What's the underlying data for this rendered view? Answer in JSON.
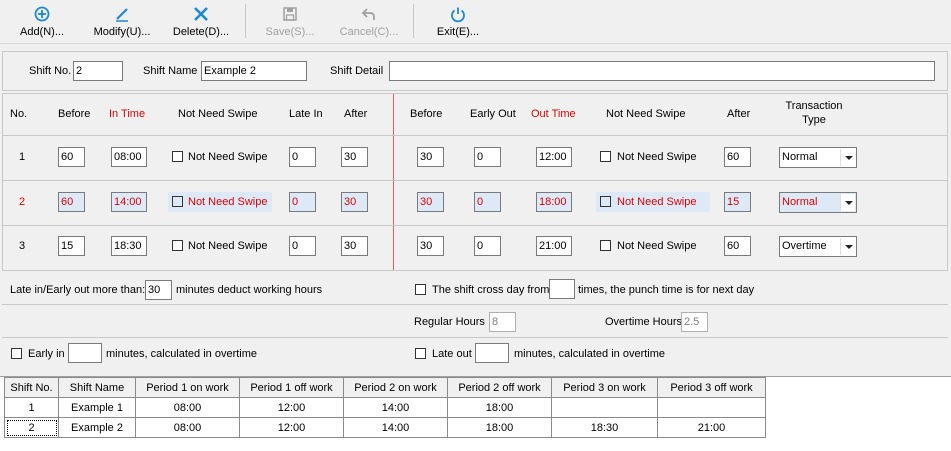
{
  "toolbar": {
    "add": "Add(N)...",
    "modify": "Modify(U)...",
    "delete": "Delete(D)...",
    "save": "Save(S)...",
    "cancel": "Cancel(C)...",
    "exit": "Exit(E)..."
  },
  "shift": {
    "no_label": "Shift No.",
    "no_value": "2",
    "name_label": "Shift Name",
    "name_value": "Example 2",
    "detail_label": "Shift Detail",
    "detail_value": ""
  },
  "headers": {
    "no": "No.",
    "before": "Before",
    "in_time": "In Time",
    "not_need_swipe": "Not Need Swipe",
    "late_in": "Late In",
    "after": "After",
    "before2": "Before",
    "early_out": "Early Out",
    "out_time": "Out Time",
    "not_need_swipe2": "Not Need Swipe",
    "after2": "After",
    "transaction_type": "Transaction Type"
  },
  "periods": [
    {
      "no": "1",
      "before": "60",
      "in_time": "08:00",
      "nns_label": "Not Need Swipe",
      "late_in": "0",
      "after": "30",
      "before2": "30",
      "early_out": "0",
      "out_time": "12:00",
      "nns2_label": "Not Need Swipe",
      "after2": "60",
      "type": "Normal"
    },
    {
      "no": "2",
      "before": "60",
      "in_time": "14:00",
      "nns_label": "Not Need Swipe",
      "late_in": "0",
      "after": "30",
      "before2": "30",
      "early_out": "0",
      "out_time": "18:00",
      "nns2_label": "Not Need Swipe",
      "after2": "15",
      "type": "Normal"
    },
    {
      "no": "3",
      "before": "15",
      "in_time": "18:30",
      "nns_label": "Not Need Swipe",
      "late_in": "0",
      "after": "30",
      "before2": "30",
      "early_out": "0",
      "out_time": "21:00",
      "nns2_label": "Not Need Swipe",
      "after2": "60",
      "type": "Overtime"
    }
  ],
  "options": {
    "late_early_prefix": "Late in/Early out more than:",
    "late_early_value": "30",
    "late_early_suffix": "minutes deduct working hours",
    "cross_day_prefix": "The shift cross day from",
    "cross_day_value": "",
    "cross_day_suffix": "times, the punch time is for next day",
    "regular_hours_label": "Regular Hours",
    "regular_hours_value": "8",
    "overtime_hours_label": "Overtime Hours",
    "overtime_hours_value": "2.5",
    "early_in_label": "Early in",
    "early_in_value": "",
    "early_in_suffix": "minutes, calculated in overtime",
    "late_out_label": "Late out",
    "late_out_value": "",
    "late_out_suffix": "minutes, calculated in overtime"
  },
  "grid": {
    "columns": [
      "Shift No.",
      "Shift Name",
      "Period 1 on work",
      "Period 1 off work",
      "Period 2 on work",
      "Period 2 off work",
      "Period 3 on work",
      "Period 3 off work"
    ],
    "rows": [
      [
        "1",
        "Example 1",
        "08:00",
        "12:00",
        "14:00",
        "18:00",
        "",
        ""
      ],
      [
        "2",
        "Example 2",
        "08:00",
        "12:00",
        "14:00",
        "18:00",
        "18:30",
        "21:00"
      ]
    ]
  },
  "colors": {
    "accent": "#1a8ad4",
    "highlight_text": "#e00000",
    "highlight_bg": "#dde9f7"
  }
}
